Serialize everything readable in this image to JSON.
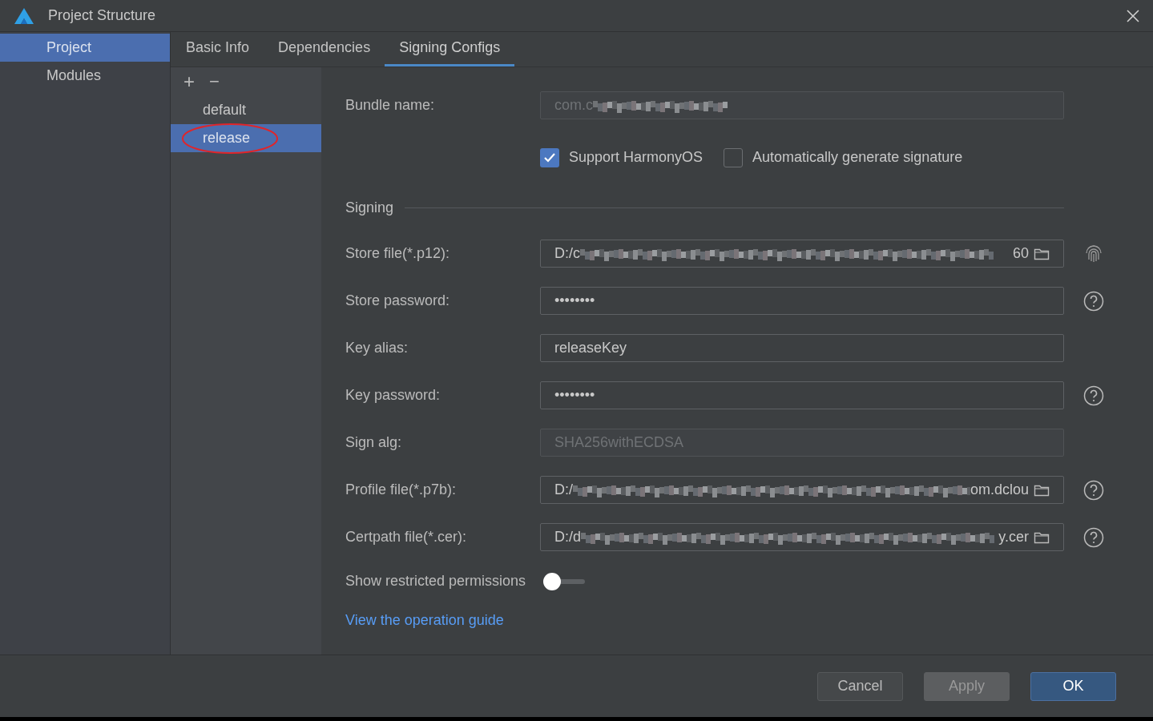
{
  "window": {
    "title": "Project Structure"
  },
  "sidebar": {
    "items": [
      {
        "label": "Project",
        "selected": true
      },
      {
        "label": "Modules",
        "selected": false
      }
    ]
  },
  "tabs": [
    {
      "label": "Basic Info",
      "selected": false
    },
    {
      "label": "Dependencies",
      "selected": false
    },
    {
      "label": "Signing Configs",
      "selected": true
    }
  ],
  "config_list": {
    "add": "+",
    "remove": "−",
    "items": [
      {
        "label": "default",
        "selected": false,
        "circled": false
      },
      {
        "label": "release",
        "selected": true,
        "circled": true
      }
    ]
  },
  "form": {
    "bundle": {
      "label": "Bundle name:",
      "value_start": "com.c",
      "disabled": true
    },
    "checkboxes": [
      {
        "label": "Support HarmonyOS",
        "checked": true
      },
      {
        "label": "Automatically generate signature",
        "checked": false
      }
    ],
    "section": "Signing",
    "fields": [
      {
        "kind": "file",
        "label": "Store file(*.p12):",
        "value_start": "D:/c",
        "value_end": "60",
        "disabled": false
      },
      {
        "kind": "text",
        "label": "Store password:",
        "value_start": "••••••••",
        "disabled": false
      },
      {
        "kind": "text",
        "label": "Key alias:",
        "value_start": "releaseKey",
        "disabled": false
      },
      {
        "kind": "text",
        "label": "Key password:",
        "value_start": "••••••••",
        "disabled": false
      },
      {
        "kind": "text",
        "label": "Sign alg:",
        "value_start": "SHA256withECDSA",
        "disabled": true
      },
      {
        "kind": "file",
        "label": "Profile file(*.p7b):",
        "value_start": "D:/",
        "value_end": "om.dclou",
        "disabled": false
      },
      {
        "kind": "file",
        "label": "Certpath file(*.cer):",
        "value_start": "D:/d",
        "value_end": "y.cer",
        "disabled": false
      }
    ],
    "toggle": {
      "label": "Show restricted permissions",
      "on": false
    },
    "link": "View the operation guide"
  },
  "buttons": [
    {
      "label": "Cancel",
      "kind": "normal"
    },
    {
      "label": "Apply",
      "kind": "disabled"
    },
    {
      "label": "OK",
      "kind": "primary"
    }
  ]
}
